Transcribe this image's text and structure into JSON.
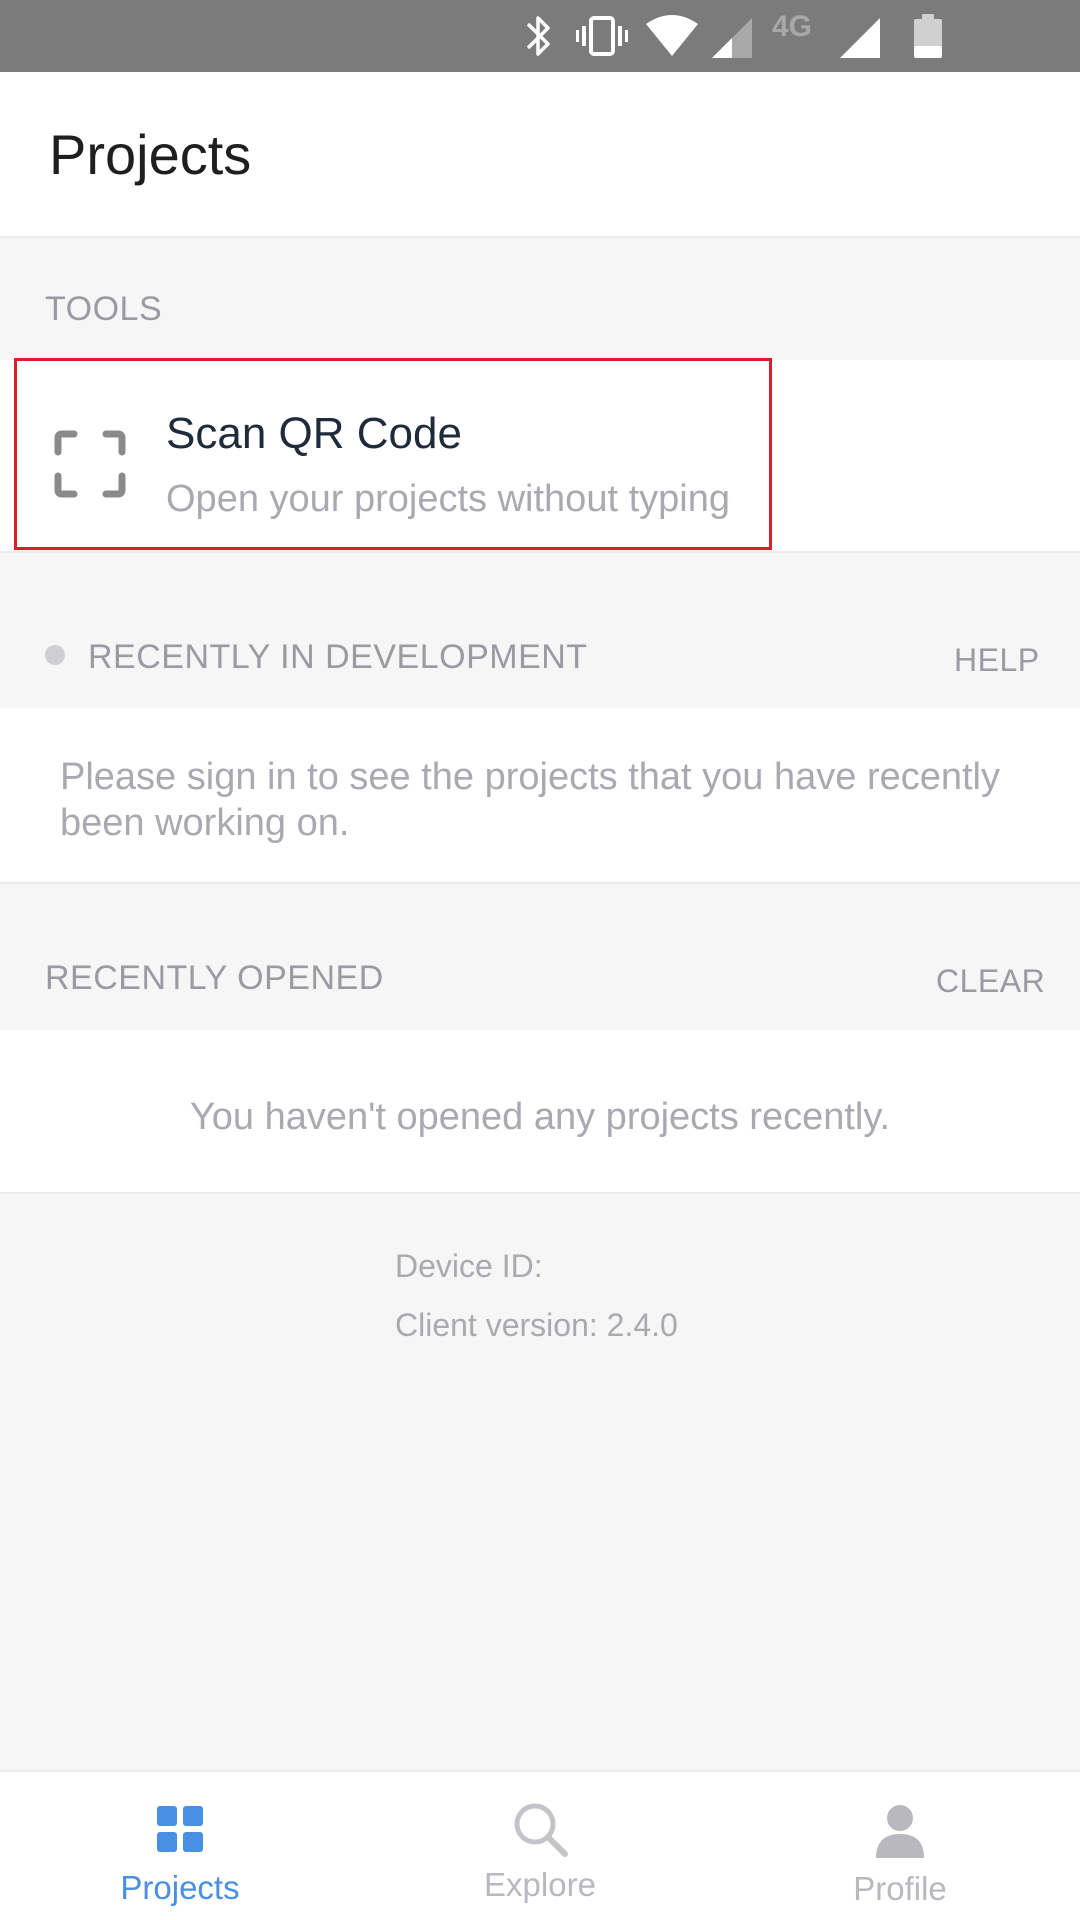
{
  "status_bar": {
    "network_label": "4G",
    "icons": [
      "bluetooth-icon",
      "vibrate-icon",
      "wifi-icon",
      "signal-icon",
      "signal-icon",
      "battery-icon"
    ]
  },
  "header": {
    "title": "Projects"
  },
  "tools": {
    "label": "TOOLS",
    "item": {
      "title": "Scan QR Code",
      "subtitle": "Open your projects without typing",
      "icon": "qr-scan-icon"
    }
  },
  "recent_dev": {
    "label": "RECENTLY IN DEVELOPMENT",
    "action": "HELP",
    "message": "Please sign in to see the projects that you have recently been working on."
  },
  "recent_opened": {
    "label": "RECENTLY OPENED",
    "action": "CLEAR",
    "message": "You haven't opened any projects recently."
  },
  "meta": {
    "device_id": "Device ID:",
    "client_version": "Client version: 2.4.0"
  },
  "tabs": [
    {
      "label": "Projects",
      "icon": "grid-icon",
      "active": true
    },
    {
      "label": "Explore",
      "icon": "search-icon",
      "active": false
    },
    {
      "label": "Profile",
      "icon": "person-icon",
      "active": false
    }
  ],
  "colors": {
    "accent": "#4a90e2",
    "inactive": "#b8b8be",
    "highlight_border": "#d8202a"
  }
}
